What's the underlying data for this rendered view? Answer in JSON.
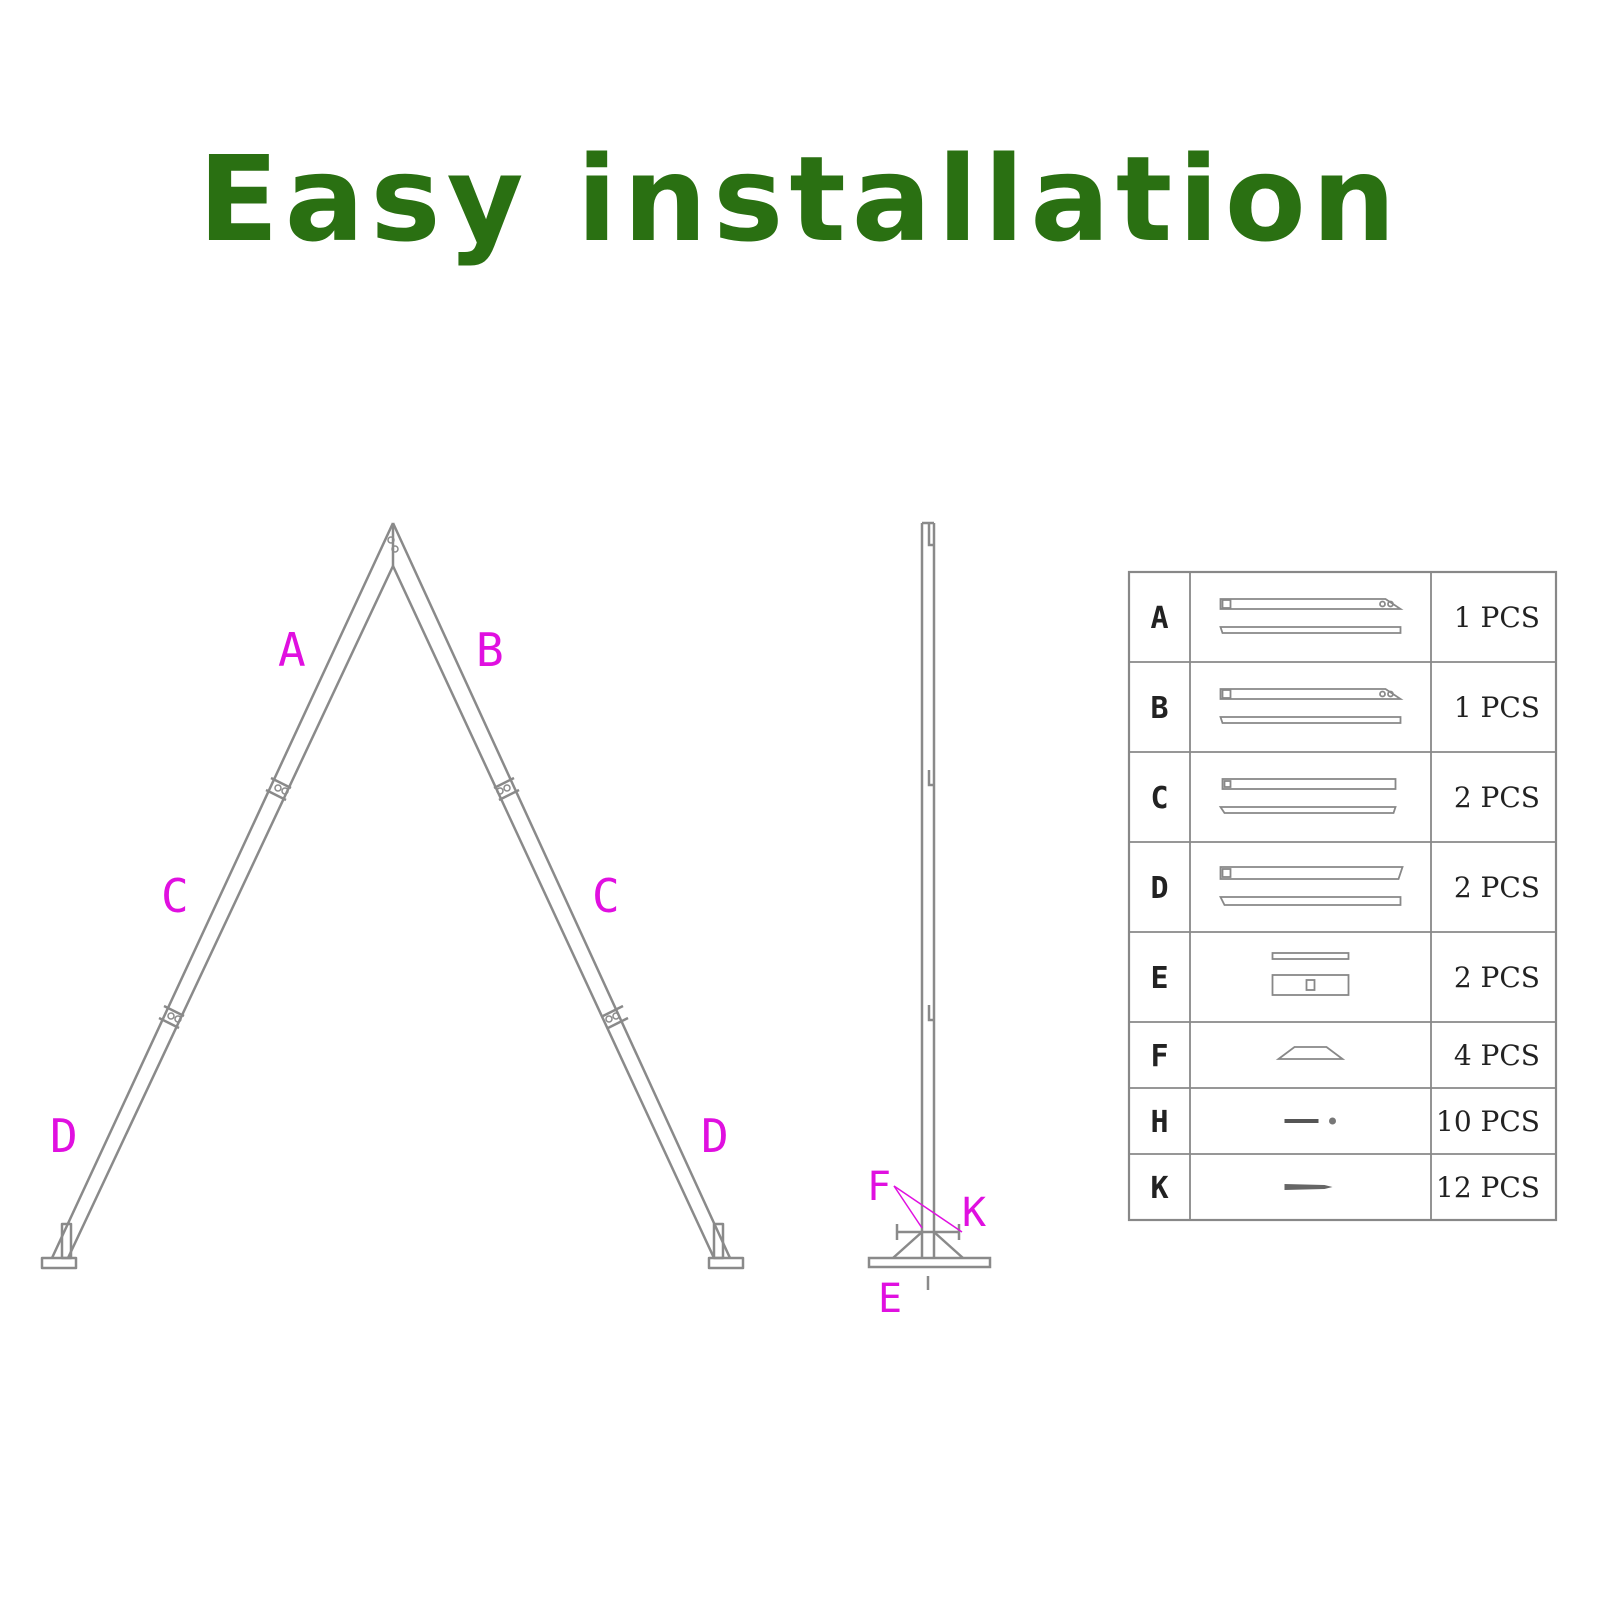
{
  "title": "Easy installation",
  "colors": {
    "title": "#2a7012",
    "labels": "#e010e0",
    "lines": "#8a8a8a",
    "table_border": "#8a8a8a"
  },
  "arch_labels": {
    "a": "A",
    "b": "B",
    "c_left": "C",
    "c_right": "C",
    "d_left": "D",
    "d_right": "D"
  },
  "side_labels": {
    "f": "F",
    "k": "K",
    "e": "E"
  },
  "parts_table": [
    {
      "part": "A",
      "icon": "long-bar-angled-end",
      "qty": "1 PCS"
    },
    {
      "part": "B",
      "icon": "long-bar-angled-end",
      "qty": "1 PCS"
    },
    {
      "part": "C",
      "icon": "straight-bar",
      "qty": "2 PCS"
    },
    {
      "part": "D",
      "icon": "bar-slanted-end",
      "qty": "2 PCS"
    },
    {
      "part": "E",
      "icon": "base-plate",
      "qty": "2 PCS"
    },
    {
      "part": "F",
      "icon": "trapezoid-bracket",
      "qty": "4 PCS"
    },
    {
      "part": "H",
      "icon": "bolt",
      "qty": "10 PCS"
    },
    {
      "part": "K",
      "icon": "screw",
      "qty": "12 PCS"
    }
  ]
}
